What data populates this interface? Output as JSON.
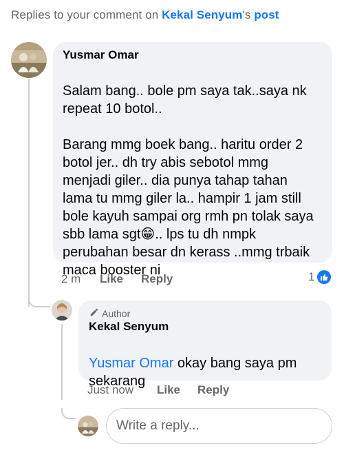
{
  "header": {
    "prefix": "Replies to your comment on ",
    "page_name": "Kekal Senyum",
    "possessive": "'s ",
    "post_link": "post"
  },
  "comment": {
    "author": "Yusmar Omar",
    "lines": [
      "Salam bang.. bole pm saya tak..saya nk",
      "repeat 10 botol..",
      "",
      "Barang mmg boek bang.. haritu order 2",
      "botol jer.. dh try abis sebotol mmg",
      "menjadi giler.. dia punya tahap tahan",
      "lama tu mmg giler la.. hampir 1 jam still",
      "bole kayuh sampai org rmh pn tolak saya",
      "sbb lama sgt",
      "perubahan besar dn kerass ..mmg trbaik",
      "maca booster ni"
    ],
    "emoji": "😁",
    "line8_suffix": ".. lps tu dh nmpk",
    "time": "2 m",
    "like_label": "Like",
    "reply_label": "Reply",
    "reaction_count": "1"
  },
  "reply": {
    "author_tag": "Author",
    "author": "Kekal Senyum",
    "mention": "Yusmar Omar",
    "text_part1": " okay bang saya pm",
    "text_line2": "sekarang",
    "time": "Just now",
    "like_label": "Like",
    "reply_label": "Reply"
  },
  "composer": {
    "placeholder": "Write a reply..."
  },
  "colors": {
    "accent": "#1877f2",
    "bubble": "#f0f2f5",
    "muted": "#65676b"
  }
}
